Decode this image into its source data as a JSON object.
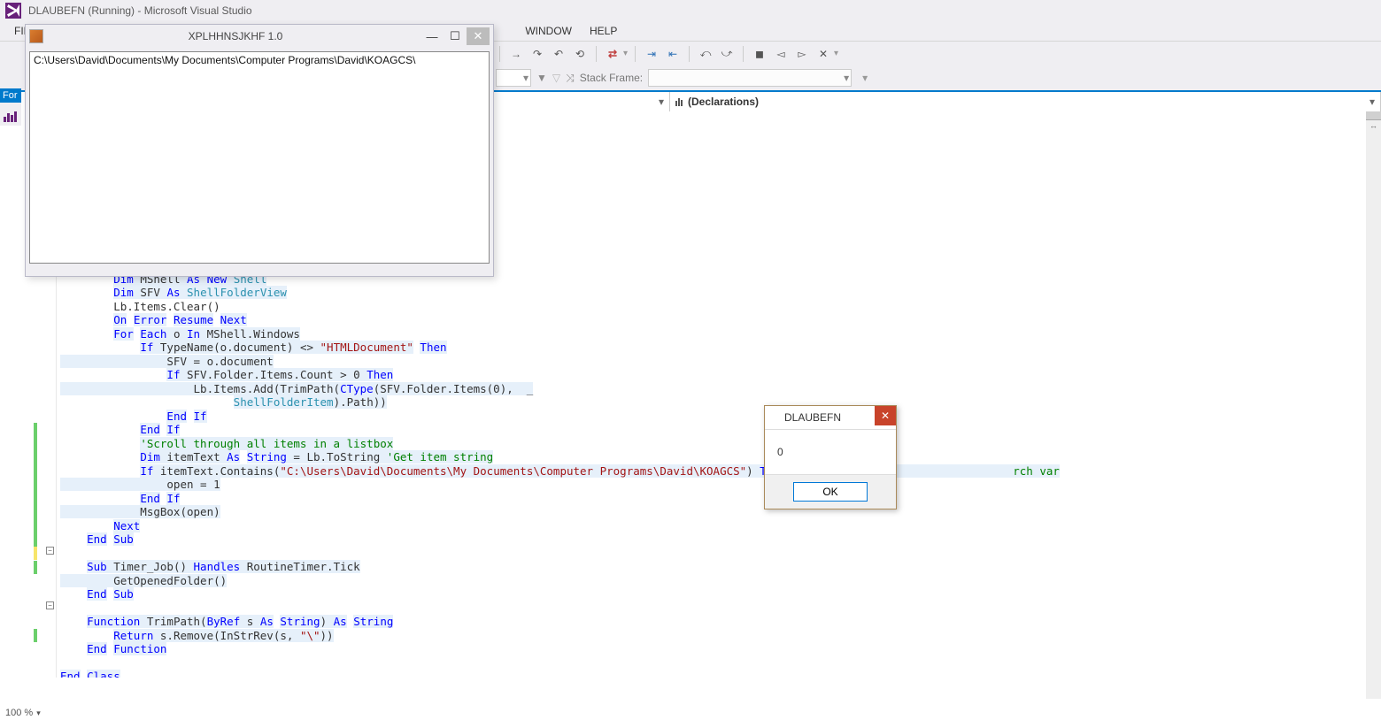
{
  "titlebar": {
    "text": "DLAUBEFN (Running) - Microsoft Visual Studio"
  },
  "menubar": {
    "file": "FIL",
    "window": "WINDOW",
    "help": "HELP"
  },
  "toolbar2": {
    "stack_frame_label": "Stack Frame:"
  },
  "leftstrip": {
    "for_label": "For"
  },
  "code_dropdowns": {
    "declarations": "(Declarations)"
  },
  "app_window": {
    "title": "XPLHHNSJKHF 1.0",
    "path": "C:\\Users\\David\\Documents\\My Documents\\Computer Programs\\David\\KOAGCS\\"
  },
  "msgbox": {
    "title": "DLAUBEFN",
    "value": "0",
    "ok": "OK"
  },
  "zoom": {
    "value": "100 %"
  },
  "code": {
    "l1a": "Dim",
    "l1b": " MShell ",
    "l1c": "As",
    "l1d": " ",
    "l1e": "New",
    "l1f": " ",
    "l1g": "Shell",
    "l2a": "Dim",
    "l2b": " SFV ",
    "l2c": "As",
    "l2d": " ",
    "l2e": "ShellFolderView",
    "l3": "        Lb.Items.Clear()",
    "l4a": "On",
    "l4b": " ",
    "l4c": "Error",
    "l4d": " ",
    "l4e": "Resume",
    "l4f": " ",
    "l4g": "Next",
    "l5a": "For",
    "l5b": " ",
    "l5c": "Each",
    "l5d": " o ",
    "l5e": "In",
    "l5f": " MShell.Windows",
    "l6a": "If",
    "l6b": " TypeName(o.document) <> ",
    "l6c": "\"HTMLDocument\"",
    "l6d": " ",
    "l6e": "Then",
    "l7": "                SFV = o.document",
    "l8a": "If",
    "l8b": " SFV.Folder.Items.Count > 0 ",
    "l8c": "Then",
    "l9a": "                    Lb.Items.Add(TrimPath(",
    "l9b": "CType",
    "l9c": "(SFV.Folder.Items(0),  _",
    "l10a": "                          ",
    "l10b": "ShellFolderItem",
    "l10c": ").Path))",
    "l11a": "End",
    "l11b": " ",
    "l11c": "If",
    "l12a": "End",
    "l12b": " ",
    "l12c": "If",
    "l13": "'Scroll through all items in a listbox",
    "l14a": "Dim",
    "l14b": " itemText ",
    "l14c": "As",
    "l14d": " ",
    "l14e": "String",
    "l14f": " = Lb.ToString ",
    "l14g": "'Get item string",
    "l15a": "If",
    "l15b": " itemText.Contains(",
    "l15c": "\"C:\\Users\\David\\Documents\\My Documents\\Computer Programs\\David\\KOAGCS\"",
    "l15d": ") ",
    "l15e": "Then",
    "l15f": " ",
    "l15g": "'Check to s                      rch var",
    "l16": "                open = 1",
    "l17a": "End",
    "l17b": " ",
    "l17c": "If",
    "l18": "            MsgBox(open)",
    "l19": "Next",
    "l20a": "End",
    "l20b": " ",
    "l20c": "Sub",
    "l21a": "Sub",
    "l21b": " Timer_Job() ",
    "l21c": "Handles",
    "l21d": " RoutineTimer.Tick",
    "l22": "        GetOpenedFolder()",
    "l23a": "End",
    "l23b": " ",
    "l23c": "Sub",
    "l24a": "Function",
    "l24b": " TrimPath(",
    "l24c": "ByRef",
    "l24d": " s ",
    "l24e": "As",
    "l24f": " ",
    "l24g": "String",
    "l24h": ") ",
    "l24i": "As",
    "l24j": " ",
    "l24k": "String",
    "l25a": "Return",
    "l25b": " s.Remove(InStrRev(s, ",
    "l25c": "\"\\\"",
    "l25d": "))",
    "l26a": "End",
    "l26b": " ",
    "l26c": "Function",
    "l27a": "End",
    "l27b": " ",
    "l27c": "Class"
  }
}
